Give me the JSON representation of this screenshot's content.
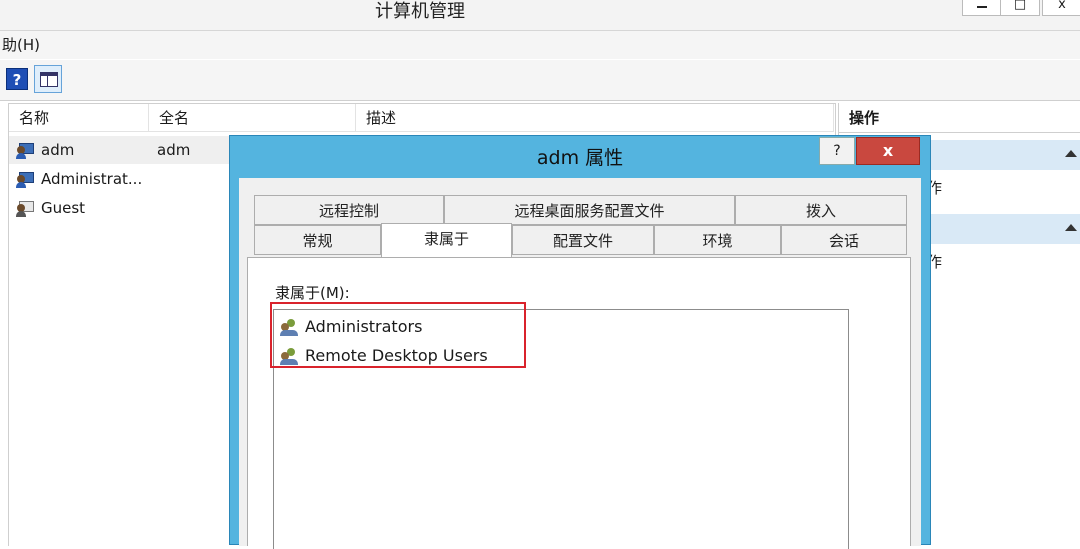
{
  "window": {
    "title": "计算机管理",
    "menu_partial": "助(H)",
    "controls": {
      "restore_glyph": "□",
      "close_glyph": "x"
    }
  },
  "toolbar": {
    "help_glyph": "?"
  },
  "list": {
    "columns": [
      "名称",
      "全名",
      "描述"
    ],
    "rows": [
      {
        "name": "adm",
        "fullname": "adm",
        "description": ""
      },
      {
        "name": "Administrat...",
        "fullname": "",
        "description": ""
      },
      {
        "name": "Guest",
        "fullname": "",
        "description": ""
      }
    ]
  },
  "actions": {
    "header": "操作",
    "items": [
      "作",
      "作"
    ]
  },
  "dialog": {
    "title": "adm 属性",
    "help_glyph": "?",
    "close_glyph": "x",
    "tabs_row1": [
      "远程控制",
      "远程桌面服务配置文件",
      "拨入"
    ],
    "tabs_row2": [
      "常规",
      "隶属于",
      "配置文件",
      "环境",
      "会话"
    ],
    "active_tab": "隶属于",
    "member_of_label": "隶属于(M):",
    "groups": [
      "Administrators",
      "Remote Desktop Users"
    ]
  },
  "colors": {
    "dialog_frame": "#54b4df",
    "close_button": "#c9483f",
    "highlight": "#d9232c",
    "action_section": "#d9e9f6"
  }
}
